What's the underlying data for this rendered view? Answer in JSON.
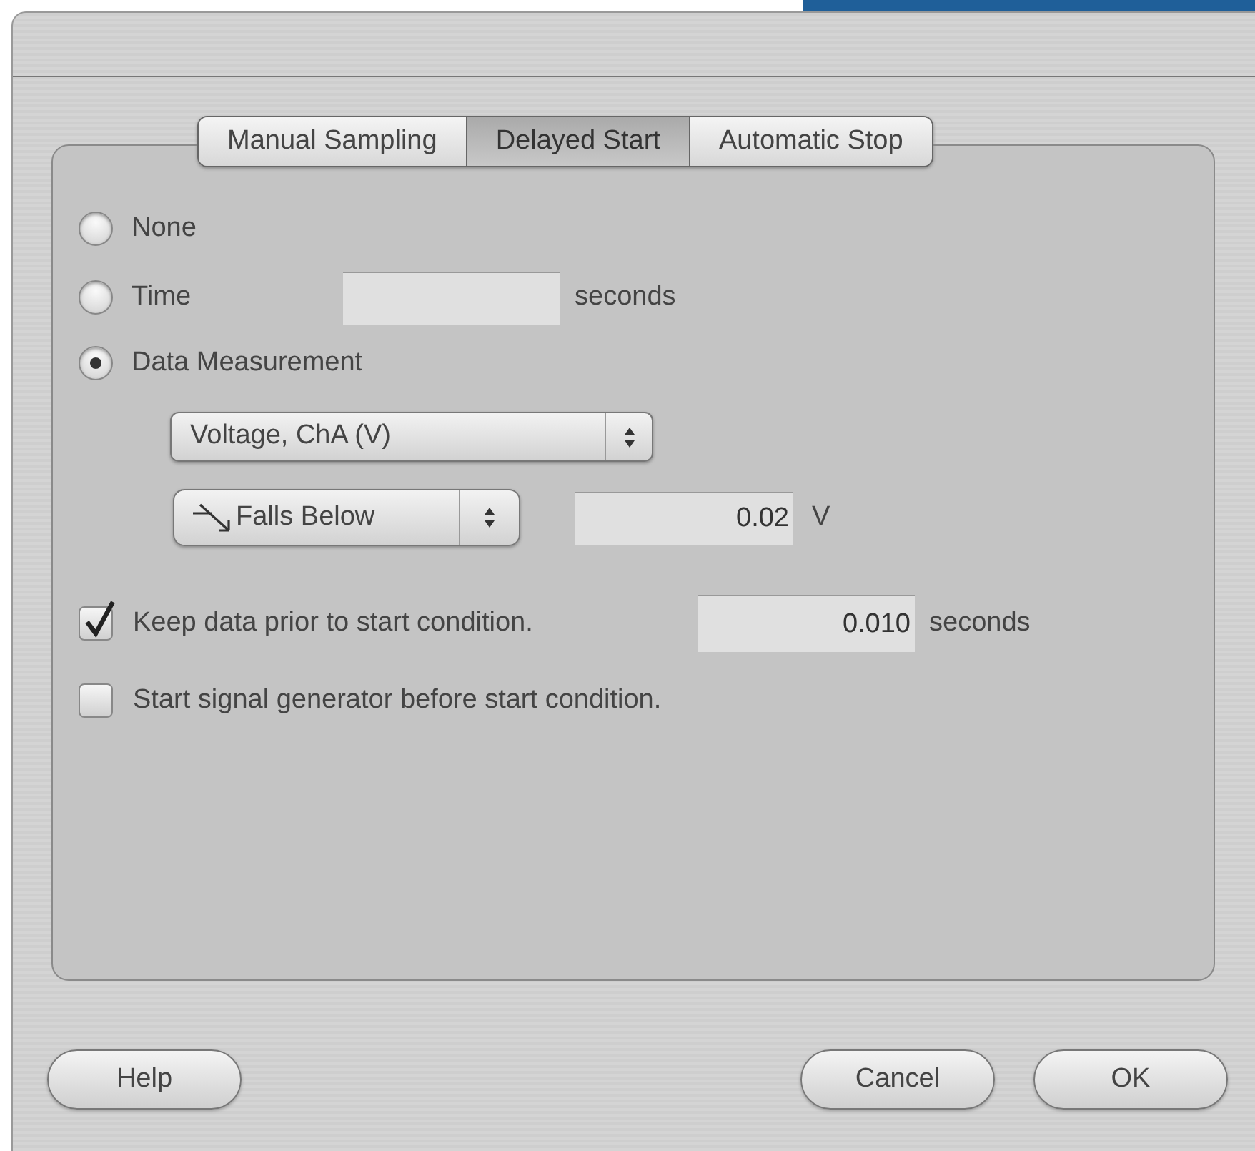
{
  "tabs": [
    {
      "label": "Manual Sampling",
      "selected": false
    },
    {
      "label": "Delayed Start",
      "selected": true
    },
    {
      "label": "Automatic Stop",
      "selected": false
    }
  ],
  "start_options": [
    {
      "label": "None",
      "selected": false
    },
    {
      "label": "Time",
      "selected": false,
      "unit": "seconds"
    },
    {
      "label": "Data Measurement",
      "selected": true
    }
  ],
  "measurement": {
    "channel": "Voltage, ChA (V)",
    "condition": "Falls Below",
    "threshold": "0.02",
    "unit": "V"
  },
  "checkboxes": [
    {
      "label": "Keep data prior to start condition.",
      "checked": true,
      "value": "0.010",
      "unit": "seconds"
    },
    {
      "label": "Start signal generator before start condition.",
      "checked": false
    }
  ],
  "buttons": [
    "Help",
    "Cancel",
    "OK"
  ]
}
